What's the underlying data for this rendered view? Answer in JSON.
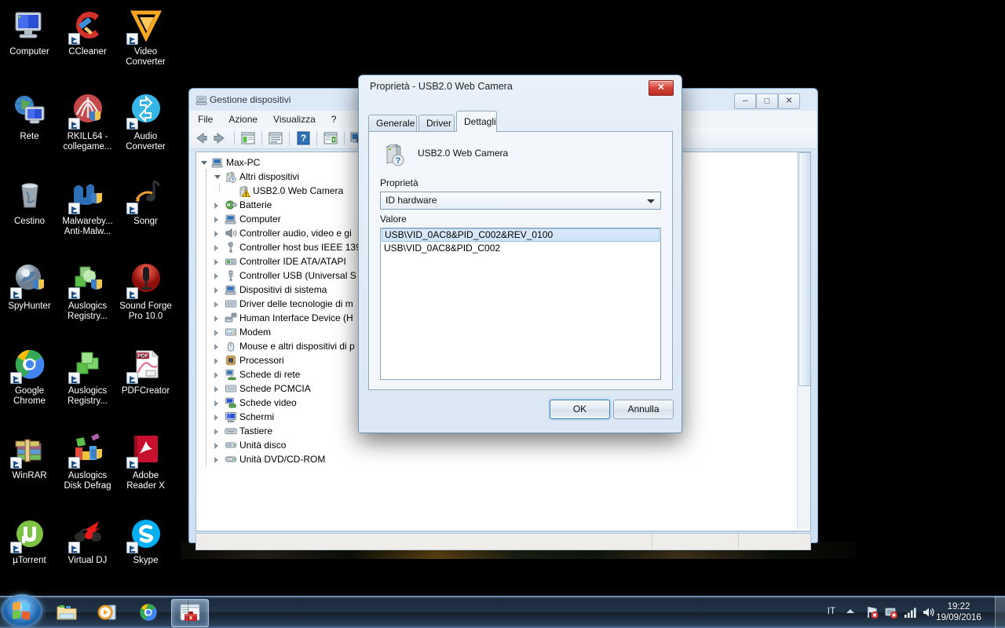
{
  "desktop": {
    "icons": [
      {
        "label": "Computer",
        "icon": "computer-icon",
        "shortcut": false
      },
      {
        "label": "CCleaner",
        "icon": "ccleaner-icon",
        "shortcut": true
      },
      {
        "label": "Video Converter",
        "icon": "video-converter-icon",
        "shortcut": true
      },
      {
        "label": "Rete",
        "icon": "network-icon",
        "shortcut": false
      },
      {
        "label": "RKILL64 - collegame...",
        "icon": "rkill-icon",
        "shortcut": true
      },
      {
        "label": "Audio Converter",
        "icon": "audio-converter-icon",
        "shortcut": true
      },
      {
        "label": "Cestino",
        "icon": "recycle-bin-icon",
        "shortcut": false
      },
      {
        "label": "Malwareby... Anti-Malw...",
        "icon": "malwarebytes-icon",
        "shortcut": true
      },
      {
        "label": "Songr",
        "icon": "songr-icon",
        "shortcut": true
      },
      {
        "label": "SpyHunter",
        "icon": "spyhunter-icon",
        "shortcut": true
      },
      {
        "label": "Auslogics Registry...",
        "icon": "auslogics-registry-icon",
        "shortcut": true
      },
      {
        "label": "Sound Forge Pro 10.0",
        "icon": "sound-forge-icon",
        "shortcut": true
      },
      {
        "label": "Google Chrome",
        "icon": "chrome-icon",
        "shortcut": true
      },
      {
        "label": "Auslogics Registry...",
        "icon": "auslogics-registry2-icon",
        "shortcut": true
      },
      {
        "label": "PDFCreator",
        "icon": "pdfcreator-icon",
        "shortcut": true
      },
      {
        "label": "WinRAR",
        "icon": "winrar-icon",
        "shortcut": true
      },
      {
        "label": "Auslogics Disk Defrag",
        "icon": "auslogics-defrag-icon",
        "shortcut": true
      },
      {
        "label": "Adobe Reader X",
        "icon": "adobe-reader-icon",
        "shortcut": true
      },
      {
        "label": "µTorrent",
        "icon": "utorrent-icon",
        "shortcut": true
      },
      {
        "label": "Virtual DJ",
        "icon": "virtualdj-icon",
        "shortcut": true
      },
      {
        "label": "Skype",
        "icon": "skype-icon",
        "shortcut": true
      }
    ]
  },
  "taskbar": {
    "start_button": "start-orb",
    "pinned": [
      {
        "name": "explorer-taskbar-button",
        "icon": "folder-icon",
        "active": false
      },
      {
        "name": "media-player-taskbar-button",
        "icon": "media-player-icon",
        "active": false
      },
      {
        "name": "chrome-taskbar-button",
        "icon": "chrome-icon",
        "active": false
      },
      {
        "name": "device-manager-taskbar-button",
        "icon": "toolbox-window-icon",
        "active": true
      }
    ],
    "tray": {
      "language": "IT",
      "show_hidden_icons": "chevron-up-icon",
      "icons": [
        {
          "name": "action-center-icon",
          "state": "error"
        },
        {
          "name": "network-icon",
          "state": "error"
        },
        {
          "name": "signal-bars-icon",
          "state": "ok"
        },
        {
          "name": "volume-icon",
          "state": "ok"
        }
      ],
      "clock_time": "19:22",
      "clock_date": "19/09/2016"
    }
  },
  "device_manager": {
    "title": "Gestione dispositivi",
    "window_icon": "device-manager-icon",
    "window_buttons": {
      "minimize": "–",
      "maximize": "□",
      "close": "✕"
    },
    "menu": [
      "File",
      "Azione",
      "Visualizza",
      "?"
    ],
    "toolbar": [
      {
        "name": "back-button",
        "icon": "back-arrow-icon"
      },
      {
        "name": "forward-button",
        "icon": "forward-arrow-icon"
      },
      {
        "name": "show-hide-console-tree-button",
        "icon": "console-tree-icon"
      },
      {
        "name": "properties-button",
        "icon": "properties-icon"
      },
      {
        "name": "help-button",
        "icon": "help-icon"
      },
      {
        "name": "update-driver-button",
        "icon": "update-driver-icon"
      },
      {
        "name": "scan-hardware-changes-button",
        "icon": "scan-hardware-icon"
      }
    ],
    "tree": [
      {
        "label": "Max-PC",
        "depth": 0,
        "expander": "open",
        "icon": "computer-node-icon"
      },
      {
        "label": "Altri dispositivi",
        "depth": 1,
        "expander": "open",
        "icon": "other-devices-icon"
      },
      {
        "label": "USB2.0 Web Camera",
        "depth": 2,
        "expander": "none",
        "icon": "unknown-device-warning-icon"
      },
      {
        "label": "Batterie",
        "depth": 1,
        "expander": "closed",
        "icon": "battery-icon"
      },
      {
        "label": "Computer",
        "depth": 1,
        "expander": "closed",
        "icon": "computer-node-icon"
      },
      {
        "label": "Controller audio, video e gi",
        "depth": 1,
        "expander": "closed",
        "icon": "audio-icon"
      },
      {
        "label": "Controller host bus IEEE 139",
        "depth": 1,
        "expander": "closed",
        "icon": "ieee1394-icon"
      },
      {
        "label": "Controller IDE ATA/ATAPI",
        "depth": 1,
        "expander": "closed",
        "icon": "ide-controller-icon"
      },
      {
        "label": "Controller USB (Universal S",
        "depth": 1,
        "expander": "closed",
        "icon": "usb-controller-icon"
      },
      {
        "label": "Dispositivi di sistema",
        "depth": 1,
        "expander": "closed",
        "icon": "system-devices-icon"
      },
      {
        "label": "Driver delle tecnologie di m",
        "depth": 1,
        "expander": "closed",
        "icon": "memory-tech-icon"
      },
      {
        "label": "Human Interface Device (H",
        "depth": 1,
        "expander": "closed",
        "icon": "hid-icon"
      },
      {
        "label": "Modem",
        "depth": 1,
        "expander": "closed",
        "icon": "modem-icon"
      },
      {
        "label": "Mouse e altri dispositivi di p",
        "depth": 1,
        "expander": "closed",
        "icon": "mouse-icon"
      },
      {
        "label": "Processori",
        "depth": 1,
        "expander": "closed",
        "icon": "processor-icon"
      },
      {
        "label": "Schede di rete",
        "depth": 1,
        "expander": "closed",
        "icon": "network-adapter-icon"
      },
      {
        "label": "Schede PCMCIA",
        "depth": 1,
        "expander": "closed",
        "icon": "pcmcia-icon"
      },
      {
        "label": "Schede video",
        "depth": 1,
        "expander": "closed",
        "icon": "display-adapter-icon"
      },
      {
        "label": "Schermi",
        "depth": 1,
        "expander": "closed",
        "icon": "monitor-icon"
      },
      {
        "label": "Tastiere",
        "depth": 1,
        "expander": "closed",
        "icon": "keyboard-icon"
      },
      {
        "label": "Unità disco",
        "depth": 1,
        "expander": "closed",
        "icon": "disk-drive-icon"
      },
      {
        "label": "Unità DVD/CD-ROM",
        "depth": 1,
        "expander": "closed",
        "icon": "dvd-drive-icon"
      }
    ],
    "status_bar": [
      "",
      "",
      ""
    ]
  },
  "dialog": {
    "title": "Proprietà - USB2.0 Web Camera",
    "close_label": "✕",
    "tabs": [
      {
        "label": "Generale",
        "selected": false
      },
      {
        "label": "Driver",
        "selected": false
      },
      {
        "label": "Dettagli",
        "selected": true
      }
    ],
    "device_icon": "unknown-device-icon",
    "device_name": "USB2.0 Web Camera",
    "property_label": "Proprietà",
    "property_selected": "ID hardware",
    "value_label": "Valore",
    "values": [
      {
        "text": "USB\\VID_0AC8&PID_C002&REV_0100",
        "selected": true
      },
      {
        "text": "USB\\VID_0AC8&PID_C002",
        "selected": false
      }
    ],
    "buttons": {
      "ok": "OK",
      "cancel": "Annulla"
    }
  }
}
